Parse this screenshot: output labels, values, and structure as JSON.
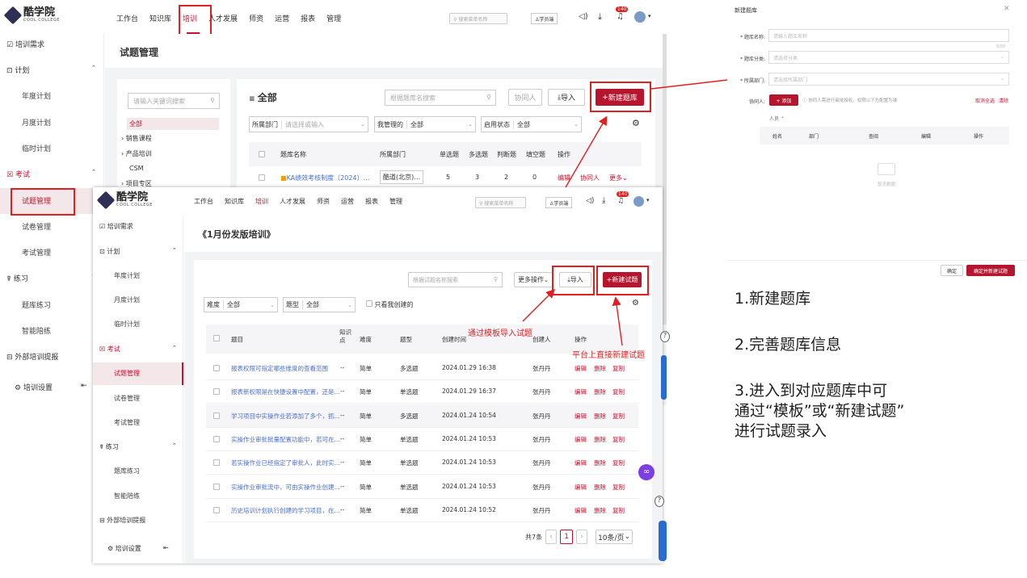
{
  "bg_app": {
    "logo": {
      "name": "酷学院",
      "sub": "COOL COLLEGE"
    },
    "nav": [
      "工作台",
      "知识库",
      "培训",
      "人才发展",
      "师资",
      "运营",
      "报表",
      "管理"
    ],
    "nav_active_index": 2,
    "search_placeholder": "搜索菜单名称",
    "user_label": "学员端",
    "badge": "140",
    "sidebar": {
      "training_demand": "培训需求",
      "plan": "计划",
      "plan_items": [
        "年度计划",
        "月度计划",
        "临时计划"
      ],
      "exam": "考试",
      "exam_items": [
        "试题管理",
        "试卷管理",
        "考试管理"
      ],
      "practice": "练习",
      "practice_items": [
        "题库练习",
        "智能陪练"
      ],
      "external": "外部培训提报",
      "settings": "培训设置"
    },
    "page_title": "试题管理",
    "left_panel": {
      "search_placeholder": "请输入关键词搜索",
      "tree": [
        "全部",
        "销售课程",
        "产品培训",
        "CSM",
        "项目专区"
      ]
    },
    "main": {
      "heading": "全部",
      "search_placeholder": "根据题库名搜索",
      "btn_collab": "协同人",
      "btn_import": "导入",
      "btn_new_bank": "新建题库",
      "filter_dept_label": "所属部门",
      "filter_dept_placeholder": "请选择或输入",
      "filter_mine_label": "我管理的",
      "filter_mine_value": "全部",
      "filter_status_label": "启用状态",
      "filter_status_value": "全部",
      "columns": [
        "题库名称",
        "所属部门",
        "单选题",
        "多选题",
        "判断题",
        "填空题",
        "操作"
      ],
      "row": {
        "name": "KA绩效考核制度（2024）…",
        "dept": "酷道(北京)…",
        "single": "5",
        "multi": "3",
        "judge": "2",
        "blank": "0",
        "ops": [
          "编辑",
          "协同人",
          "更多"
        ]
      }
    }
  },
  "fg_app": {
    "logo": {
      "name": "酷学院",
      "sub": "COOL COLLEGE"
    },
    "nav": [
      "工作台",
      "知识库",
      "培训",
      "人才发展",
      "师资",
      "运营",
      "报表",
      "管理"
    ],
    "search_placeholder": "搜索菜单名称",
    "user_label": "学员端",
    "badge": "140",
    "sidebar": {
      "training_demand": "培训需求",
      "plan": "计划",
      "plan_items": [
        "年度计划",
        "月度计划",
        "临时计划"
      ],
      "exam": "考试",
      "exam_items": [
        "试题管理",
        "试卷管理",
        "考试管理"
      ],
      "practice": "练习",
      "practice_items": [
        "题库练习",
        "智能陪练"
      ],
      "external": "外部培训提报",
      "settings": "培训设置"
    },
    "page_title": "《1月份发版培训》",
    "search_placeholder2": "根据试题名称搜索",
    "btn_more": "更多操作",
    "btn_import": "导入",
    "btn_new_question": "新建试题",
    "filter_diff_label": "难度",
    "filter_diff_value": "全部",
    "filter_type_label": "题型",
    "filter_type_value": "全部",
    "only_mine": "只看我创建的",
    "columns": [
      "题目",
      "知识点",
      "难度",
      "题型",
      "创建时间",
      "创建人",
      "操作"
    ],
    "rows": [
      {
        "title": "报表权限可指定哪些维度的查看范围",
        "kp": "--",
        "diff": "简单",
        "type": "多选题",
        "time": "2024.01.29 16:38",
        "creator": "张丹丹"
      },
      {
        "title": "报表新权限是在快捷设置中配置，还是...",
        "kp": "--",
        "diff": "简单",
        "type": "单选题",
        "time": "2024.01.29 16:37",
        "creator": "张丹丹"
      },
      {
        "title": "学习项目中实操作业若添加了多个，抓...",
        "kp": "--",
        "diff": "简单",
        "type": "多选题",
        "time": "2024.01.24 10:54",
        "creator": "张丹丹"
      },
      {
        "title": "实操作业审批批量配置功能中，若可在...",
        "kp": "--",
        "diff": "简单",
        "type": "单选题",
        "time": "2024.01.24 10:53",
        "creator": "张丹丹"
      },
      {
        "title": "若实操作业已经指定了审批人，此时实...",
        "kp": "--",
        "diff": "简单",
        "type": "单选题",
        "time": "2024.01.24 10:53",
        "creator": "张丹丹"
      },
      {
        "title": "实操作业审批流中，可由实操作业创建...",
        "kp": "--",
        "diff": "简单",
        "type": "单选题",
        "time": "2024.01.24 10:53",
        "creator": "张丹丹"
      },
      {
        "title": "历史培训计划执行创建的学习项目，在...",
        "kp": "--",
        "diff": "简单",
        "type": "单选题",
        "time": "2024.01.24 10:52",
        "creator": "张丹丹"
      }
    ],
    "row_ops": [
      "编辑",
      "删除",
      "复制"
    ],
    "pager": {
      "total": "共7条",
      "page": "1",
      "size": "10条/页"
    }
  },
  "annotations": {
    "import_note": "通过模板导入试题",
    "new_note": "平台上直接新建试题"
  },
  "dialog": {
    "title": "新建题库",
    "fields": [
      {
        "label": "* 题库名称:",
        "placeholder": "请输入题库名称"
      },
      {
        "label": "* 题库分类:",
        "placeholder": "请选择分类"
      },
      {
        "label": "* 所属部门:",
        "placeholder": "请选择所属部门"
      }
    ],
    "counter": "0/50",
    "collab_label": "协同人:",
    "add_btn": "+ 添加",
    "collab_hint": "协同人需进行审批授权，权限以下方配置为准",
    "cancel_all": "取消全选",
    "clear": "清除",
    "people_label": "人员",
    "columns": [
      "姓名",
      "部门",
      "查阅",
      "编辑",
      "操作"
    ],
    "empty": "暂无数据",
    "btn_ok": "确定",
    "btn_ok_new": "确定并新建试题"
  },
  "steps": {
    "s1": "1.新建题库",
    "s2": "2.完善题库信息",
    "s3_l1": "3.进入到对应题库中可",
    "s3_l2": "通过“模板”或“新建试题”",
    "s3_l3": "进行试题录入"
  }
}
